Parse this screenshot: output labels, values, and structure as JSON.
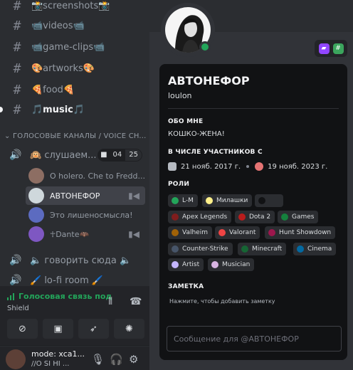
{
  "channels": [
    {
      "name": "📸screenshots📸",
      "active": false
    },
    {
      "name": "📹videos📹",
      "active": false
    },
    {
      "name": "📹game-clips📹",
      "active": false
    },
    {
      "name": "🎨artworks🎨",
      "active": false
    },
    {
      "name": "🍕food🍕",
      "active": false
    },
    {
      "name": "🎵music🎵",
      "active": true
    }
  ],
  "voice_category": "ГОЛОСОВЫЕ КАНАЛЫ / VOICE CH...",
  "voice_channels": [
    {
      "name": "🙉 слушаем...",
      "video_count": "04",
      "user_count": "25"
    },
    {
      "name": "🔈 говорить сюда 🔈"
    },
    {
      "name": "🖌️ lo-fi room 🖌️"
    }
  ],
  "voice_users": [
    {
      "name": "O holero. Che to Fredd...",
      "selected": false,
      "camera": false,
      "color": "#8d6e63"
    },
    {
      "name": "АВТОНЕФОР",
      "selected": true,
      "camera": true,
      "color": "#cfd8dc"
    },
    {
      "name": "Это лишеносмысла!",
      "selected": false,
      "camera": false,
      "color": "#5c6bc0"
    },
    {
      "name": "☥Dante🦇",
      "selected": false,
      "camera": true,
      "color": "#7e57c2"
    }
  ],
  "voice_connection": {
    "title": "Голосовая связь под",
    "subtitle": "Shield",
    "status_color": "#23a55a"
  },
  "user_panel": {
    "name": "mode: xca1...",
    "status": "//O SI HI ..."
  },
  "profile": {
    "display_name": "АВТОНЕФОР",
    "username": "loulon",
    "about_heading": "ОБО МНЕ",
    "about_text": "КОШКО-ЖЕНА!",
    "member_heading": "В ЧИСЛЕ УЧАСТНИКОВ С",
    "member_discord": "21 нояб. 2017 г.",
    "member_server": "19 нояб. 2023 г.",
    "roles_heading": "РОЛИ",
    "roles": [
      {
        "name": "L-M",
        "color": "#23a55a"
      },
      {
        "name": "Милашки",
        "color": "#fef08a"
      },
      {
        "name": "",
        "color": "#111214"
      },
      {
        "name": "Apex Legends",
        "color": "#7f1d1d"
      },
      {
        "name": "Dota 2",
        "color": "#b91c1c"
      },
      {
        "name": "Games",
        "color": "#15803d"
      },
      {
        "name": "Valheim",
        "color": "#a16207"
      },
      {
        "name": "Valorant",
        "color": "#ef4444"
      },
      {
        "name": "Hunt Showdown",
        "color": "#9d174d"
      },
      {
        "name": "Counter-Strike",
        "color": "#475569"
      },
      {
        "name": "Minecraft",
        "color": "#166534"
      },
      {
        "name": "Cinema",
        "color": "#0369a1"
      },
      {
        "name": "Artist",
        "color": "#c4b5fd"
      },
      {
        "name": "Musician",
        "color": "#d8b4e2"
      }
    ],
    "note_heading": "ЗАМЕТКА",
    "note_placeholder": "Нажмите, чтобы добавить заметку",
    "message_placeholder": "Сообщение для @АВТОНЕФОР",
    "status_color": "#23a55a"
  }
}
